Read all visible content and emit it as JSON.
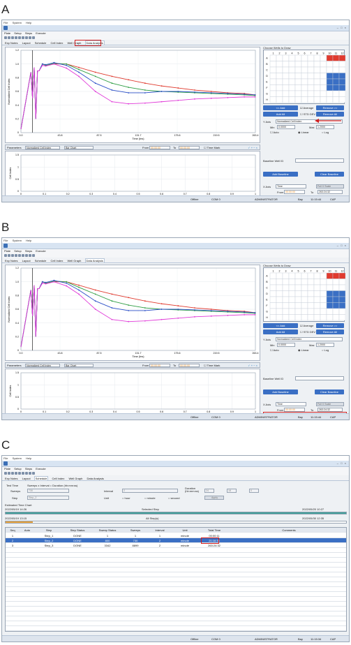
{
  "panels": [
    {
      "label": "A"
    },
    {
      "label": "B"
    },
    {
      "label": "C"
    }
  ],
  "app": {
    "top_menu": [
      "File",
      "System",
      "Help"
    ],
    "main_menu": [
      "Plate",
      "Setup",
      "Steps",
      "Execute"
    ],
    "tabs": [
      "Exp Notes",
      "Layout",
      "Schedule",
      "Cell Index",
      "Well Graph",
      "Data Analysis"
    ],
    "window_buttons": "– □ ×",
    "accent": "#3a6fc4",
    "highlight_red": "#d21f1f"
  },
  "chart_data": [
    {
      "type": "line",
      "title": "",
      "xlabel": "Time (hrs)",
      "ylabel": "Normalized Cell Index",
      "xlim": [
        0,
        283.4
      ],
      "ylim": [
        0,
        1.2
      ],
      "x_ticks": [
        "0.0",
        "43.8",
        "87.5",
        "131.7",
        "175.6",
        "219.5",
        "263.4"
      ],
      "y_ticks": [
        "0",
        "0.2",
        "0.4",
        "0.6",
        "0.8",
        "1.0",
        "1.2"
      ],
      "series": [
        {
          "color": "#e03a2e",
          "x": [
            0,
            12,
            14,
            16,
            18,
            20,
            22,
            26,
            30,
            40,
            55,
            70,
            90,
            110,
            130,
            150,
            170,
            190,
            210,
            230,
            250,
            270,
            283
          ],
          "y": [
            0.05,
            0.88,
            0.5,
            0.95,
            0.2,
            0.9,
            0.9,
            1.0,
            0.98,
            1.0,
            1.0,
            0.95,
            0.88,
            0.82,
            0.77,
            0.72,
            0.68,
            0.65,
            0.62,
            0.6,
            0.58,
            0.57,
            0.55
          ]
        },
        {
          "color": "#2f9e44",
          "x": [
            0,
            12,
            14,
            16,
            18,
            20,
            22,
            26,
            30,
            40,
            55,
            70,
            90,
            110,
            130,
            150,
            170,
            190,
            210,
            230,
            250,
            270,
            283
          ],
          "y": [
            0.05,
            0.88,
            0.5,
            0.95,
            0.2,
            0.9,
            0.9,
            1.0,
            0.98,
            1.01,
            1.0,
            0.92,
            0.82,
            0.72,
            0.66,
            0.62,
            0.6,
            0.59,
            0.58,
            0.57,
            0.56,
            0.55,
            0.54
          ]
        },
        {
          "color": "#2b4fc7",
          "x": [
            0,
            12,
            14,
            16,
            18,
            20,
            22,
            26,
            30,
            40,
            55,
            70,
            90,
            110,
            130,
            150,
            170,
            190,
            210,
            230,
            250,
            270,
            283
          ],
          "y": [
            0.05,
            0.88,
            0.5,
            0.95,
            0.2,
            0.9,
            0.9,
            1.0,
            0.99,
            1.02,
            0.98,
            0.88,
            0.72,
            0.62,
            0.58,
            0.58,
            0.6,
            0.6,
            0.59,
            0.58,
            0.57,
            0.56,
            0.55
          ]
        },
        {
          "color": "#e03ad8",
          "x": [
            0,
            12,
            14,
            16,
            18,
            20,
            22,
            26,
            30,
            40,
            55,
            70,
            90,
            110,
            130,
            150,
            170,
            190,
            210,
            230,
            250,
            270,
            283
          ],
          "y": [
            0.05,
            0.88,
            0.5,
            0.95,
            0.2,
            0.9,
            0.9,
            0.98,
            0.97,
            1.0,
            0.94,
            0.82,
            0.6,
            0.45,
            0.42,
            0.43,
            0.45,
            0.47,
            0.49,
            0.5,
            0.51,
            0.52,
            0.52
          ]
        }
      ]
    },
    {
      "type": "bar",
      "xlabel": "Time(hrs)",
      "ylabel": "Cell Index",
      "xlim": [
        0,
        1
      ],
      "ylim": [
        0,
        1.5
      ],
      "x_ticks": [
        "0",
        "0.1",
        "0.2",
        "0.3",
        "0.4",
        "0.5",
        "0.6",
        "0.7",
        "0.8",
        "0.9",
        "1"
      ],
      "y_ticks": [
        "0",
        "0.5",
        "1",
        "1.5"
      ]
    }
  ],
  "analysis_panel": {
    "parameters_label": "Parameters",
    "param_select": "Normalized Cell Index",
    "chart_select": "Bar Chart",
    "from_label": "From",
    "from_value": "00:00:00",
    "to_label": "To",
    "to_value": "00:00:00",
    "time_mark_label": "Time Mark",
    "chart_icons": "✓ + − ×"
  },
  "right_panel": {
    "choose_title": "Choose Wells to Draw",
    "rows": [
      "A",
      "B",
      "C",
      "D",
      "E",
      "F",
      "G",
      "H"
    ],
    "cols": [
      "1",
      "2",
      "3",
      "4",
      "5",
      "6",
      "7",
      "8",
      "9",
      "10",
      "11",
      "12"
    ],
    "add_button": "<< Add",
    "average_label": "Average",
    "remove_button": "Remove >>",
    "add_all_button": "Add All",
    "std_dev_label": "STD DEV",
    "remove_all_button": "Remove All",
    "y_axis_label": "Y Axis",
    "y_axis_value": "Normalized Cell Index",
    "min_label": "Min",
    "min_value": "0.0000",
    "max_label": "Max",
    "max_value": "1.2000",
    "auto_label": "Auto",
    "linear_label": "Linear",
    "log_label": "Log",
    "baseline_label": "Baseline Well ID",
    "add_baseline": "Add Baseline",
    "clear_baseline": "Clear Baseline",
    "x_axis_label": "X Axis",
    "x_axis_value": "Time",
    "full_x_scale": "Full X Scale",
    "from_label": "From",
    "from_value": "00:00:00",
    "to_label": "To",
    "to_value": "263:24:32",
    "norm_time_label": "Normalization Time",
    "norm_time_value": "21:16:35"
  },
  "statusbar": {
    "offline": "Offline",
    "com": "COM 0",
    "user": "ADMINISTRATOR",
    "bay": "Bay",
    "time_a": "11:15:44",
    "time_b": "11:15:44",
    "time_c": "11:15:34",
    "cap": "CAP"
  },
  "schedule": {
    "test_time": "Test Time",
    "formula": "Sweeps x Interval = Duration (hh:mm:ss)",
    "sweeps_label": "Sweeps",
    "sweeps_value": "730",
    "interval_label": "Interval",
    "interval_value": "2",
    "duration_label": "Duration (hh:mm:ss)",
    "dur_h": "24",
    "dur_m": "18",
    "dur_s": "0",
    "step_label": "Step",
    "step_value": "Step_2",
    "unit_label": "Unit",
    "unit_hour": "hour",
    "unit_minute": "minute",
    "unit_second": "second",
    "apply_button": "Apply",
    "est_chart": "Estimated Time Chart",
    "sel_step": "Selected Step",
    "sel_start": "2022/05/19 14:26",
    "sel_end": "2022/05/20 10:27",
    "all_steps": "All Step(s)",
    "all_start": "2022/05/19 13:15",
    "all_end": "2022/05/30 12:35",
    "headers": [
      "Seq",
      "Auto",
      "Step",
      "Step Status",
      "Sweep Status",
      "Sweeps",
      "Interval",
      "Unit",
      "Total Time",
      "Comments"
    ],
    "rows": [
      [
        "1",
        "",
        "Step_1",
        "DONE",
        "1",
        "1",
        "1",
        "minute",
        "00:00:11",
        ""
      ],
      [
        "2",
        "",
        "Step_2",
        "DONE",
        "800",
        "730",
        "2",
        "minute",
        "21:16:35",
        ""
      ],
      [
        "3",
        "",
        "Step_3",
        "DONE",
        "3342",
        "8899",
        "2",
        "minute",
        "263:24:32",
        ""
      ]
    ]
  }
}
